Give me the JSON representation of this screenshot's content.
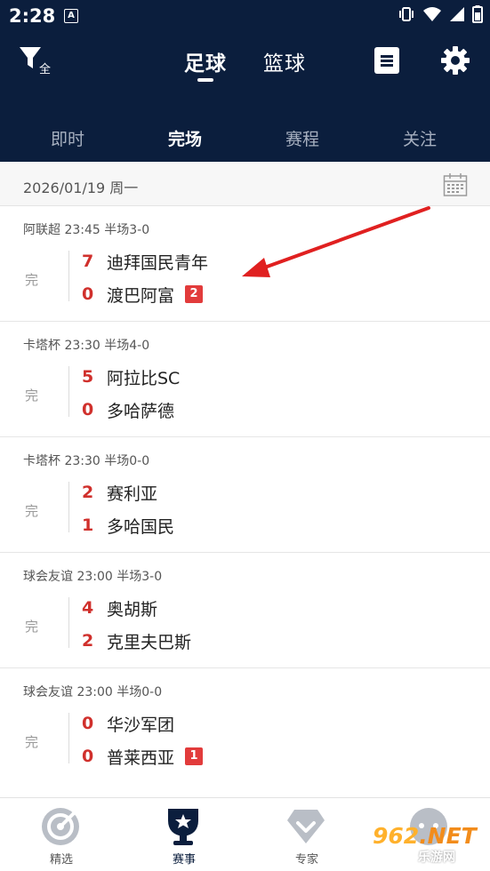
{
  "statusbar": {
    "time": "2:28",
    "notif_letter": "A"
  },
  "header": {
    "filter_label": "全",
    "sport_tabs": [
      "足球",
      "篮球"
    ],
    "active_sport": "足球"
  },
  "subtabs": [
    "即时",
    "完场",
    "赛程",
    "关注"
  ],
  "active_subtab": "完场",
  "date": "2026/01/19 周一",
  "matches": [
    {
      "league": "阿联超",
      "time": "23:45",
      "half": "半场3-0",
      "status": "完",
      "home": {
        "score": "7",
        "name": "迪拜国民青年"
      },
      "away": {
        "score": "0",
        "name": "渡巴阿富",
        "card": "2"
      }
    },
    {
      "league": "卡塔杯",
      "time": "23:30",
      "half": "半场4-0",
      "status": "完",
      "home": {
        "score": "5",
        "name": "阿拉比SC"
      },
      "away": {
        "score": "0",
        "name": "多哈萨德"
      }
    },
    {
      "league": "卡塔杯",
      "time": "23:30",
      "half": "半场0-0",
      "status": "完",
      "home": {
        "score": "2",
        "name": "赛利亚"
      },
      "away": {
        "score": "1",
        "name": "多哈国民"
      }
    },
    {
      "league": "球会友谊",
      "time": "23:00",
      "half": "半场3-0",
      "status": "完",
      "home": {
        "score": "4",
        "name": "奥胡斯"
      },
      "away": {
        "score": "2",
        "name": "克里夫巴斯"
      }
    },
    {
      "league": "球会友谊",
      "time": "23:00",
      "half": "半场0-0",
      "status": "完",
      "home": {
        "score": "0",
        "name": "华沙军团"
      },
      "away": {
        "score": "0",
        "name": "普莱西亚",
        "card": "1"
      }
    }
  ],
  "bottom_nav": [
    {
      "label": "精选",
      "icon": "target-icon"
    },
    {
      "label": "赛事",
      "icon": "trophy-icon"
    },
    {
      "label": "专家",
      "icon": "expert-badge-icon"
    },
    {
      "label": "",
      "icon": "chat-icon"
    }
  ],
  "active_nav": "赛事",
  "watermark": {
    "number": "962",
    "suffix": ".NET",
    "sub": "乐游网"
  },
  "colors": {
    "header_bg": "#0b1e3d",
    "score_red": "#d0302c",
    "card_red": "#e23b3b",
    "annotation_arrow": "#e02020"
  }
}
